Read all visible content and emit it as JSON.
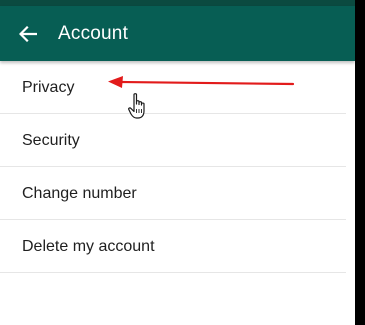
{
  "app_bar": {
    "title": "Account",
    "back_icon": "arrow-left-icon",
    "color": "#075e54"
  },
  "menu": {
    "items": [
      {
        "label": "Privacy"
      },
      {
        "label": "Security"
      },
      {
        "label": "Change number"
      },
      {
        "label": "Delete my account"
      }
    ]
  },
  "annotation": {
    "arrow_color": "#e21b1b",
    "cursor_icon": "hand-pointer-icon"
  }
}
